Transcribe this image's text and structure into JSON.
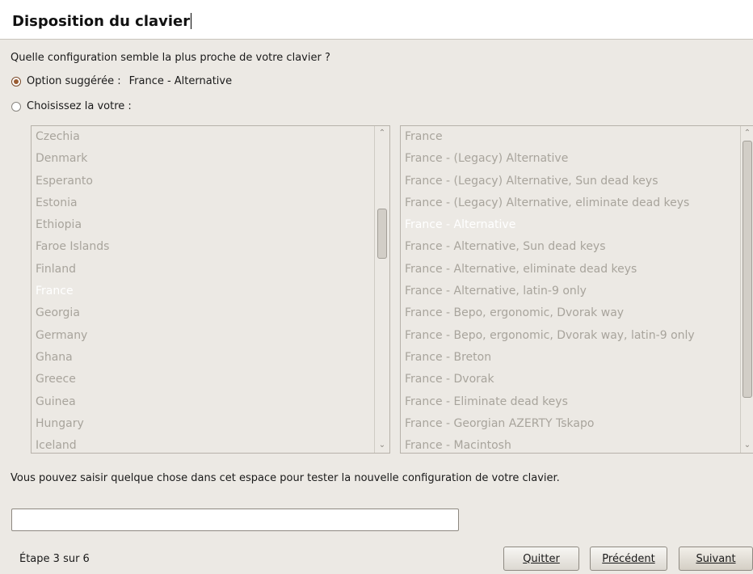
{
  "header": {
    "title": "Disposition du clavier"
  },
  "question": "Quelle configuration semble la plus proche de votre clavier ?",
  "options": {
    "suggested_label": "Option suggérée :",
    "suggested_value": "France - Alternative",
    "choose_label": "Choisissez la votre :"
  },
  "countries": {
    "items": [
      "Czechia",
      "Denmark",
      "Esperanto",
      "Estonia",
      "Ethiopia",
      "Faroe Islands",
      "Finland",
      "France",
      "Georgia",
      "Germany",
      "Ghana",
      "Greece",
      "Guinea",
      "Hungary",
      "Iceland"
    ],
    "selected": "France"
  },
  "variants": {
    "items": [
      "France",
      "France - (Legacy) Alternative",
      "France - (Legacy) Alternative, Sun dead keys",
      "France - (Legacy) Alternative, eliminate dead keys",
      "France - Alternative",
      "France - Alternative, Sun dead keys",
      "France - Alternative, eliminate dead keys",
      "France - Alternative, latin-9 only",
      "France - Bepo, ergonomic, Dvorak way",
      "France - Bepo, ergonomic, Dvorak way, latin-9 only",
      "France - Breton",
      "France - Dvorak",
      "France - Eliminate dead keys",
      "France - Georgian AZERTY Tskapo",
      "France - Macintosh"
    ],
    "selected": "France - Alternative"
  },
  "icons": {
    "scroll_up": "up-arrow-icon",
    "scroll_down": "down-arrow-icon"
  },
  "test": {
    "help": "Vous pouvez saisir quelque chose dans cet espace pour tester la nouvelle configuration de votre clavier.",
    "value": ""
  },
  "footer": {
    "step": "Étape 3 sur 6",
    "quit": "Quitter",
    "previous": "Précédent",
    "next": "Suivant"
  },
  "colors": {
    "selected_text": "#ffffff",
    "unselected_text": "#a8a49c",
    "radio_checked": "#9a5c32"
  }
}
